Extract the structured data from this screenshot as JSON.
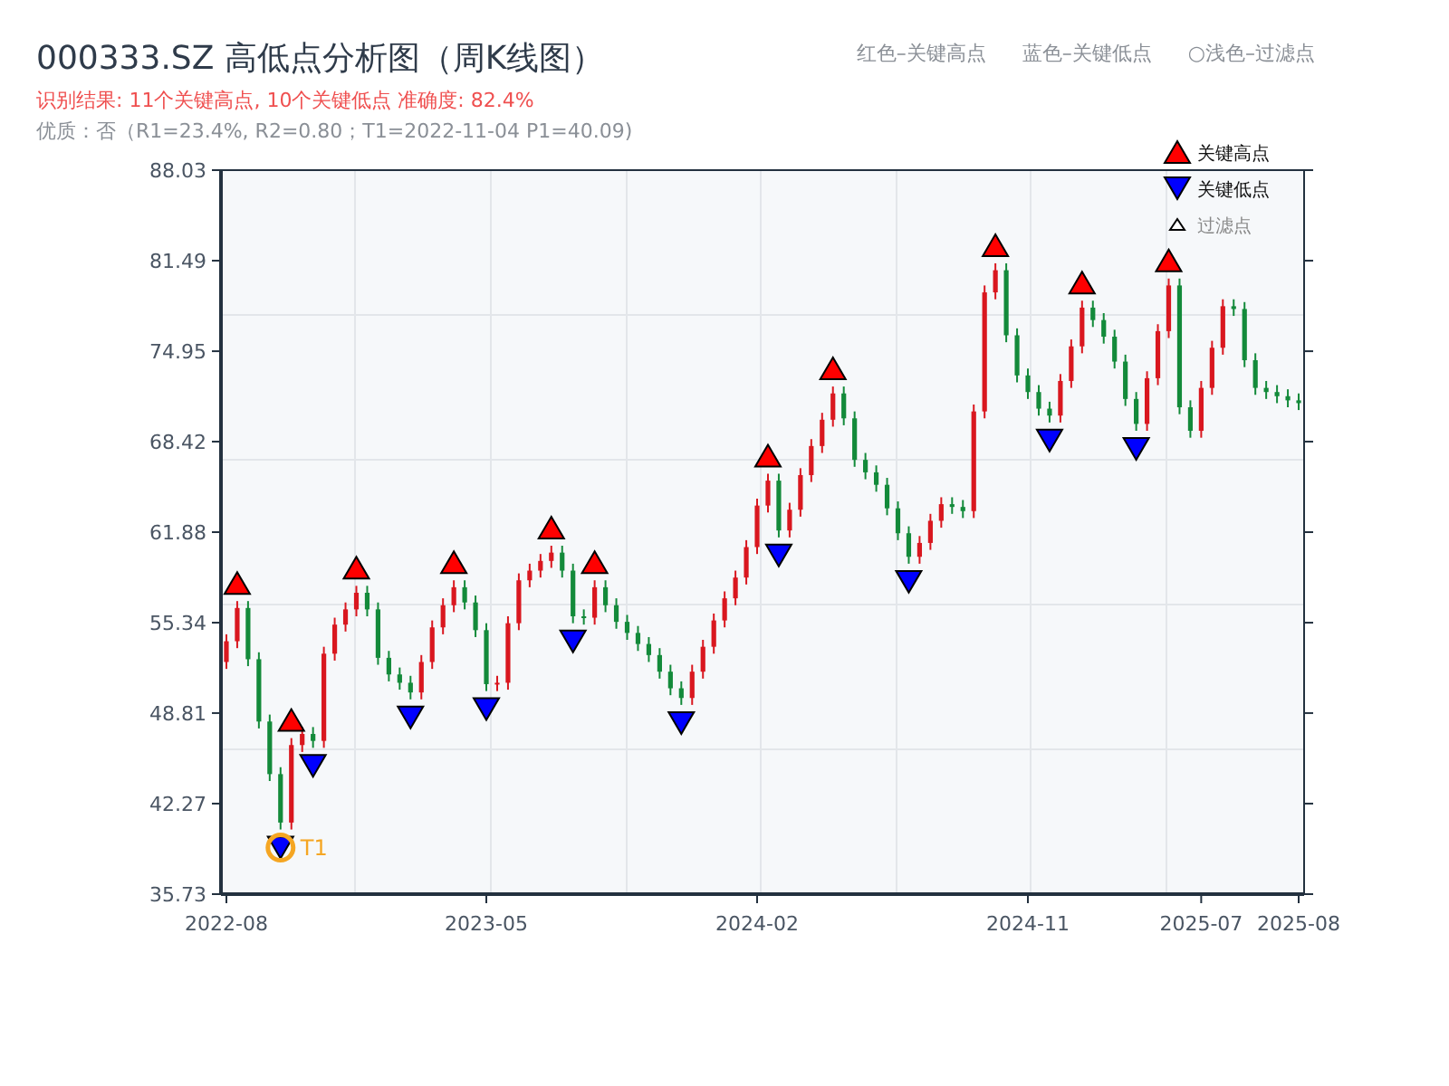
{
  "title": "000333.SZ 高低点分析图（周K线图）",
  "result_line": "识别结果: 11个关键高点, 10个关键低点  准确度: 82.4%",
  "quality_line": "优质：否（R1=23.4%, R2=0.80；T1=2022-11-04 P1=40.09)",
  "color_key": [
    "红色–关键高点",
    "蓝色–关键低点",
    "○浅色–过滤点"
  ],
  "chart": {
    "chart_data": {
      "type": "candlestick",
      "categories": [
        "2022-08",
        null,
        null,
        null,
        null,
        null,
        null,
        null,
        null,
        null,
        null,
        null,
        null,
        null,
        null,
        null,
        null,
        null,
        null,
        null,
        null,
        null,
        null,
        null,
        "2023-05",
        null,
        null,
        null,
        null,
        null,
        null,
        null,
        null,
        null,
        null,
        null,
        null,
        null,
        null,
        null,
        null,
        null,
        null,
        null,
        null,
        null,
        null,
        null,
        null,
        "2024-02",
        null,
        null,
        null,
        null,
        null,
        null,
        null,
        null,
        null,
        null,
        null,
        null,
        null,
        null,
        null,
        null,
        null,
        null,
        null,
        null,
        null,
        null,
        null,
        null,
        "2024-11",
        null,
        null,
        null,
        null,
        null,
        null,
        null,
        null,
        null,
        null,
        null,
        null,
        null,
        null,
        null,
        "2025-07",
        null,
        null,
        null,
        null,
        null,
        null,
        null,
        null,
        "2025-08"
      ],
      "ohlc": [
        [
          52.5,
          54.5,
          52.0,
          54.0
        ],
        [
          54.0,
          56.9,
          53.5,
          56.4
        ],
        [
          56.4,
          56.9,
          52.2,
          52.7
        ],
        [
          52.7,
          53.2,
          47.7,
          48.2
        ],
        [
          48.2,
          48.7,
          43.9,
          44.4
        ],
        [
          44.4,
          44.9,
          40.4,
          40.9
        ],
        [
          40.9,
          47.0,
          40.4,
          46.5
        ],
        [
          46.5,
          47.8,
          46.0,
          47.3
        ],
        [
          47.3,
          47.8,
          46.3,
          46.8
        ],
        [
          46.8,
          53.6,
          46.3,
          53.1
        ],
        [
          53.1,
          55.7,
          52.6,
          55.2
        ],
        [
          55.2,
          56.8,
          54.7,
          56.3
        ],
        [
          56.3,
          58.0,
          55.8,
          57.5
        ],
        [
          57.5,
          58.0,
          55.8,
          56.3
        ],
        [
          56.3,
          56.8,
          52.3,
          52.8
        ],
        [
          52.8,
          53.3,
          51.1,
          51.6
        ],
        [
          51.6,
          52.1,
          50.5,
          51.0
        ],
        [
          51.0,
          51.5,
          49.8,
          50.3
        ],
        [
          50.3,
          53.0,
          49.8,
          52.5
        ],
        [
          52.5,
          55.5,
          52.0,
          55.0
        ],
        [
          55.0,
          57.1,
          54.5,
          56.6
        ],
        [
          56.6,
          58.4,
          56.1,
          57.9
        ],
        [
          57.9,
          58.4,
          56.3,
          56.8
        ],
        [
          56.8,
          57.3,
          54.3,
          54.8
        ],
        [
          54.8,
          55.3,
          50.4,
          50.9
        ],
        [
          50.9,
          51.5,
          50.4,
          51.0
        ],
        [
          51.0,
          55.8,
          50.5,
          55.3
        ],
        [
          55.3,
          58.9,
          54.8,
          58.4
        ],
        [
          58.4,
          59.6,
          57.9,
          59.1
        ],
        [
          59.1,
          60.3,
          58.6,
          59.8
        ],
        [
          59.8,
          60.9,
          59.3,
          60.4
        ],
        [
          60.4,
          60.9,
          58.6,
          59.1
        ],
        [
          59.1,
          59.6,
          55.3,
          55.8
        ],
        [
          55.8,
          56.3,
          55.2,
          55.7
        ],
        [
          55.7,
          58.4,
          55.2,
          57.9
        ],
        [
          57.9,
          58.4,
          56.1,
          56.6
        ],
        [
          56.6,
          57.1,
          54.9,
          55.4
        ],
        [
          55.4,
          55.9,
          54.1,
          54.6
        ],
        [
          54.6,
          55.1,
          53.3,
          53.8
        ],
        [
          53.8,
          54.3,
          52.5,
          53.0
        ],
        [
          53.0,
          53.5,
          51.3,
          51.8
        ],
        [
          51.8,
          52.3,
          50.1,
          50.6
        ],
        [
          50.6,
          51.1,
          49.4,
          49.9
        ],
        [
          49.9,
          52.3,
          49.4,
          51.8
        ],
        [
          51.8,
          54.1,
          51.3,
          53.6
        ],
        [
          53.6,
          56.0,
          53.1,
          55.5
        ],
        [
          55.5,
          57.6,
          55.0,
          57.1
        ],
        [
          57.1,
          59.1,
          56.6,
          58.6
        ],
        [
          58.6,
          61.3,
          58.1,
          60.8
        ],
        [
          60.8,
          64.3,
          60.3,
          63.8
        ],
        [
          63.8,
          66.1,
          63.3,
          65.6
        ],
        [
          65.6,
          66.1,
          61.5,
          62.0
        ],
        [
          62.0,
          64.0,
          61.5,
          63.5
        ],
        [
          63.5,
          66.5,
          63.0,
          66.0
        ],
        [
          66.0,
          68.6,
          65.5,
          68.1
        ],
        [
          68.1,
          70.5,
          67.6,
          70.0
        ],
        [
          70.0,
          72.4,
          69.5,
          71.9
        ],
        [
          71.9,
          72.4,
          69.6,
          70.1
        ],
        [
          70.1,
          70.6,
          66.6,
          67.1
        ],
        [
          67.1,
          67.6,
          65.7,
          66.2
        ],
        [
          66.2,
          66.7,
          64.8,
          65.3
        ],
        [
          65.3,
          65.8,
          63.1,
          63.6
        ],
        [
          63.6,
          64.1,
          61.3,
          61.8
        ],
        [
          61.8,
          62.3,
          59.6,
          60.1
        ],
        [
          60.1,
          61.6,
          59.6,
          61.1
        ],
        [
          61.1,
          63.2,
          60.6,
          62.7
        ],
        [
          62.7,
          64.4,
          62.2,
          63.9
        ],
        [
          63.9,
          64.4,
          63.2,
          63.7
        ],
        [
          63.7,
          64.2,
          62.9,
          63.4
        ],
        [
          63.4,
          71.1,
          62.9,
          70.6
        ],
        [
          70.6,
          79.7,
          70.1,
          79.2
        ],
        [
          79.2,
          81.3,
          78.7,
          80.8
        ],
        [
          80.8,
          81.3,
          75.6,
          76.1
        ],
        [
          76.1,
          76.6,
          72.7,
          73.2
        ],
        [
          73.2,
          73.7,
          71.5,
          72.0
        ],
        [
          72.0,
          72.5,
          70.3,
          70.8
        ],
        [
          70.8,
          71.3,
          69.8,
          70.3
        ],
        [
          70.3,
          73.3,
          69.8,
          72.8
        ],
        [
          72.8,
          75.8,
          72.3,
          75.3
        ],
        [
          75.3,
          78.6,
          74.8,
          78.1
        ],
        [
          78.1,
          78.6,
          76.7,
          77.2
        ],
        [
          77.2,
          77.7,
          75.5,
          76.0
        ],
        [
          76.0,
          76.5,
          73.7,
          74.2
        ],
        [
          74.2,
          74.7,
          71.0,
          71.5
        ],
        [
          71.5,
          72.0,
          69.2,
          69.7
        ],
        [
          69.7,
          73.5,
          69.2,
          73.0
        ],
        [
          73.0,
          76.9,
          72.5,
          76.4
        ],
        [
          76.4,
          80.2,
          75.9,
          79.7
        ],
        [
          79.7,
          80.2,
          70.4,
          70.9
        ],
        [
          70.9,
          71.4,
          68.7,
          69.2
        ],
        [
          69.2,
          72.8,
          68.7,
          72.3
        ],
        [
          72.3,
          75.7,
          71.8,
          75.2
        ],
        [
          75.2,
          78.7,
          74.7,
          78.2
        ],
        [
          78.2,
          78.7,
          77.5,
          78.0
        ],
        [
          78.0,
          78.5,
          73.8,
          74.3
        ],
        [
          74.3,
          74.8,
          71.8,
          72.3
        ],
        [
          72.3,
          72.8,
          71.5,
          72.0
        ],
        [
          72.0,
          72.5,
          71.2,
          71.7
        ],
        [
          71.7,
          72.2,
          70.9,
          71.4
        ],
        [
          71.4,
          71.9,
          70.7,
          71.2
        ]
      ],
      "ylim": [
        35.73,
        88.03
      ],
      "yticks": [
        {
          "value": 88.03,
          "label": "88.03"
        },
        {
          "value": 81.49,
          "label": "81.49"
        },
        {
          "value": 74.95,
          "label": "74.95"
        },
        {
          "value": 68.42,
          "label": "68.42"
        },
        {
          "value": 61.88,
          "label": "61.88"
        },
        {
          "value": 55.34,
          "label": "55.34"
        },
        {
          "value": 48.81,
          "label": "48.81"
        },
        {
          "value": 42.27,
          "label": "42.27"
        },
        {
          "value": 35.73,
          "label": "35.73"
        }
      ],
      "annotations": [
        "T1"
      ]
    },
    "legend": [
      {
        "kind": "high",
        "label": "关键高点"
      },
      {
        "kind": "low",
        "label": "关键低点"
      },
      {
        "kind": "filtered",
        "label": "过滤点"
      }
    ]
  }
}
